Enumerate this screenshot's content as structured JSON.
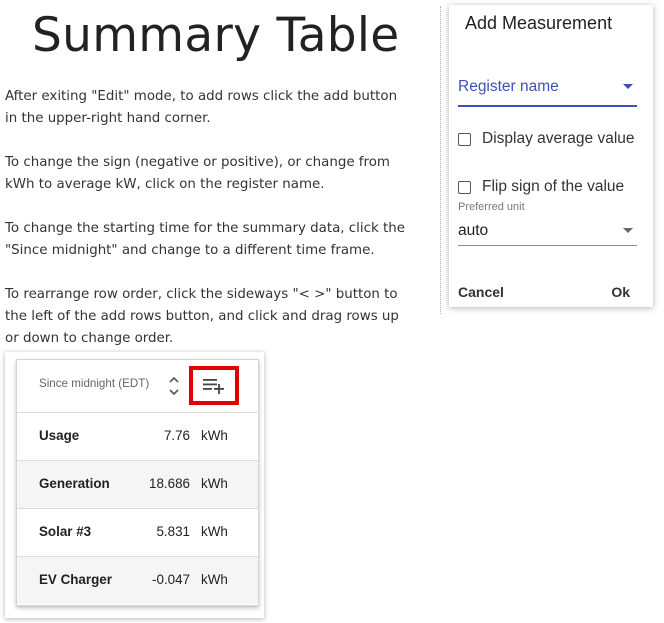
{
  "page": {
    "title": "Summary Table",
    "help_paragraphs": [
      "After exiting \"Edit\" mode, to add rows click the add button in the upper-right hand corner.",
      "To change the sign (negative or positive), or change from kWh to average kW, click on the register name.",
      "To change the starting time for the summary data, click the \"Since midnight\" and change to a different time frame.",
      "To rearrange row order, click the sideways \"< >\" button to the left of the add rows button, and click and drag rows up or down to change order."
    ]
  },
  "summary_widget": {
    "time_frame": "Since midnight (EDT)",
    "reorder_icon": "unfold-more-icon",
    "add_rows_icon": "playlist-add-icon",
    "highlight_color": "#e00000",
    "rows": [
      {
        "name": "Usage",
        "value": "7.76",
        "unit": "kWh"
      },
      {
        "name": "Generation",
        "value": "18.686",
        "unit": "kWh"
      },
      {
        "name": "Solar #3",
        "value": "5.831",
        "unit": "kWh"
      },
      {
        "name": "EV Charger",
        "value": "-0.047",
        "unit": "kWh"
      }
    ]
  },
  "dialog": {
    "title": "Add Measurement",
    "register_select": {
      "value": "Register name",
      "accent_color": "#3f51b5"
    },
    "display_average": {
      "label": "Display average value",
      "checked": false
    },
    "flip_sign": {
      "label": "Flip sign of the value",
      "checked": false
    },
    "preferred_unit": {
      "label": "Preferred unit",
      "value": "auto"
    },
    "cancel_label": "Cancel",
    "ok_label": "Ok"
  }
}
